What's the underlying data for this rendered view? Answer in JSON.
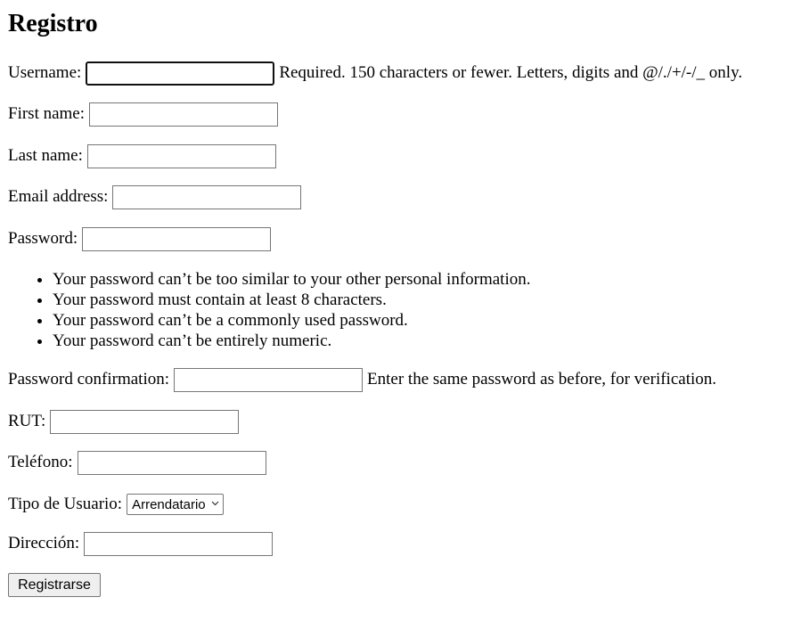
{
  "page": {
    "title": "Registro"
  },
  "form": {
    "username": {
      "label": "Username:",
      "value": "",
      "help": "Required. 150 characters or fewer. Letters, digits and @/./+/-/_ only."
    },
    "first_name": {
      "label": "First name:",
      "value": ""
    },
    "last_name": {
      "label": "Last name:",
      "value": ""
    },
    "email": {
      "label": "Email address:",
      "value": ""
    },
    "password": {
      "label": "Password:",
      "value": "",
      "rules": [
        "Your password can’t be too similar to your other personal information.",
        "Your password must contain at least 8 characters.",
        "Your password can’t be a commonly used password.",
        "Your password can’t be entirely numeric."
      ]
    },
    "password_confirmation": {
      "label": "Password confirmation:",
      "value": "",
      "help": "Enter the same password as before, for verification."
    },
    "rut": {
      "label": "RUT:",
      "value": ""
    },
    "telefono": {
      "label": "Teléfono:",
      "value": ""
    },
    "tipo_usuario": {
      "label": "Tipo de Usuario:",
      "selected": "Arrendatario",
      "icon": "chevron-down-icon"
    },
    "direccion": {
      "label": "Dirección:",
      "value": ""
    },
    "submit_label": "Registrarse"
  }
}
